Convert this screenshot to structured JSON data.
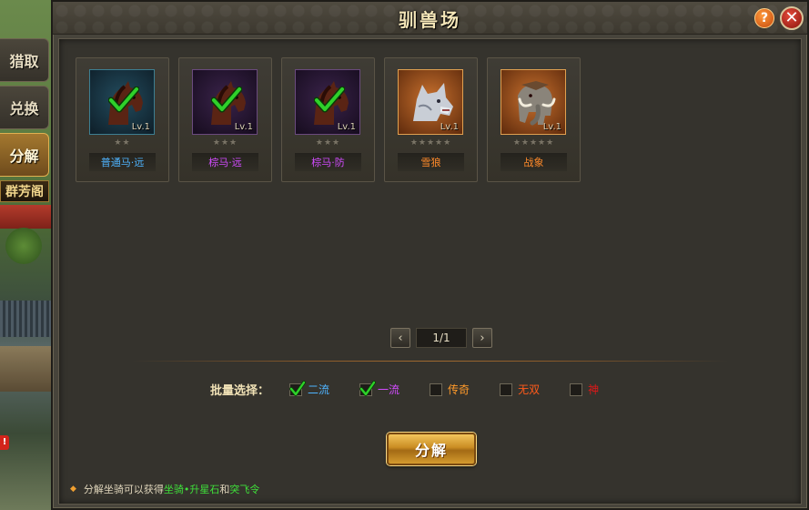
{
  "window": {
    "title": "驯兽场",
    "help_glyph": "?",
    "close_glyph": "✕"
  },
  "side_tabs": [
    {
      "label": "猎取",
      "active": false
    },
    {
      "label": "兑换",
      "active": false
    },
    {
      "label": "分解",
      "active": true
    }
  ],
  "background_sign": "群芳阁",
  "background_badge": "!",
  "cards": [
    {
      "name": "普通马·远",
      "level": "Lv.1",
      "stars": "★★",
      "checked": true,
      "name_color": "#4fb4ff",
      "frame": "blue",
      "beast": "horse-icon"
    },
    {
      "name": "棕马·远",
      "level": "Lv.1",
      "stars": "★★★",
      "checked": true,
      "name_color": "#d24cff",
      "frame": "purple",
      "beast": "horse-icon"
    },
    {
      "name": "棕马·防",
      "level": "Lv.1",
      "stars": "★★★",
      "checked": true,
      "name_color": "#d24cff",
      "frame": "purple",
      "beast": "horse-icon"
    },
    {
      "name": "雪狼",
      "level": "Lv.1",
      "stars": "★★★★★",
      "checked": false,
      "name_color": "#ff8a2a",
      "frame": "orange",
      "beast": "wolf-icon"
    },
    {
      "name": "战象",
      "level": "Lv.1",
      "stars": "★★★★★",
      "checked": false,
      "name_color": "#ff8a2a",
      "frame": "orange",
      "beast": "elephant-icon"
    }
  ],
  "pager": {
    "prev": "‹",
    "next": "›",
    "page": "1/1"
  },
  "batch": {
    "label": "批量选择：",
    "options": [
      {
        "label": "二流",
        "checked": true,
        "color": "#4fb4ff"
      },
      {
        "label": "一流",
        "checked": true,
        "color": "#d24cff"
      },
      {
        "label": "传奇",
        "checked": false,
        "color": "#ff9a2a"
      },
      {
        "label": "无双",
        "checked": false,
        "color": "#ff5a1a"
      },
      {
        "label": "神",
        "checked": false,
        "color": "#e01818"
      }
    ]
  },
  "decompose_button": "分解",
  "hint": {
    "bullet": "◆",
    "prefix": "分解坐骑可以获得",
    "item1": "坐骑•升星石",
    "joiner": "和",
    "item2": "突飞令"
  },
  "colors": {
    "accent_gold": "#c98c23",
    "hint_green": "#3fe03a",
    "check_green": "#2fd12a"
  }
}
